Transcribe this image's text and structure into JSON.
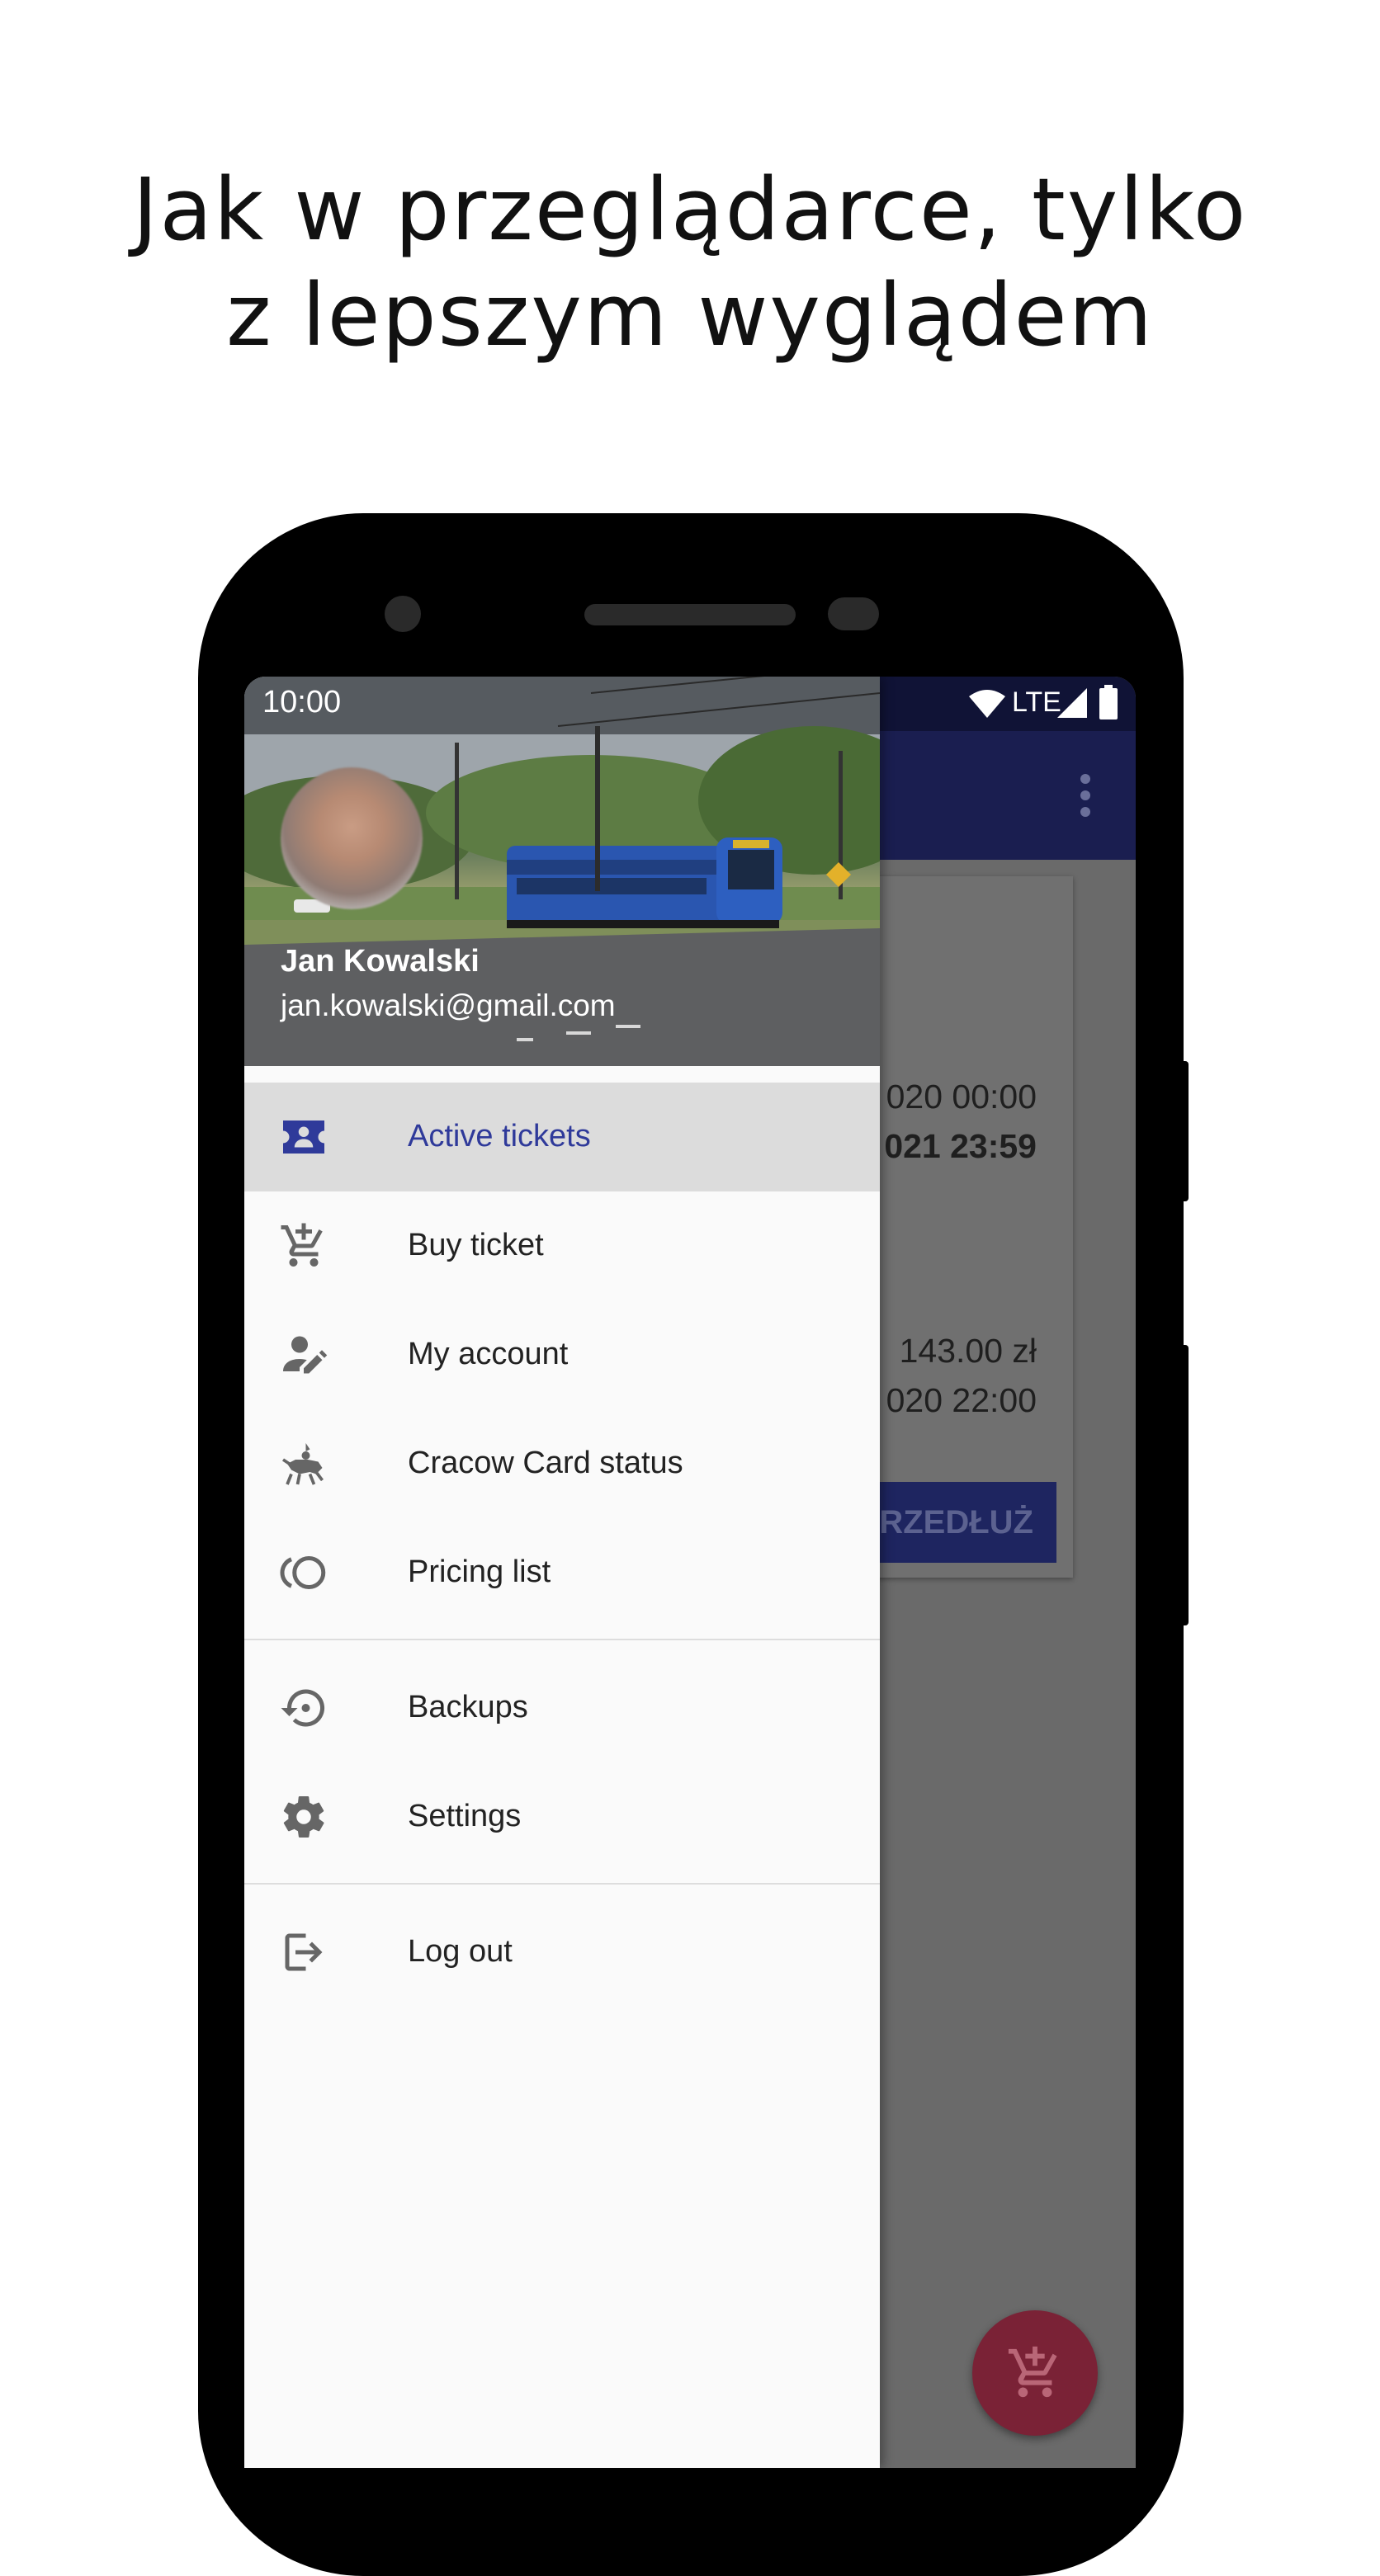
{
  "headline": {
    "line1": "Jak w przeglądarce, tylko",
    "line2": "z lepszym wyglądem"
  },
  "status_bar": {
    "time": "10:00",
    "network": "LTE",
    "icons": [
      "wifi-icon",
      "signal-icon",
      "battery-icon"
    ]
  },
  "drawer": {
    "user_name": "Jan Kowalski",
    "user_email": "jan.kowalski@gmail.com",
    "menu": [
      {
        "label": "Active tickets",
        "icon": "ticket-icon",
        "active": true
      },
      {
        "label": "Buy ticket",
        "icon": "cart-add-icon",
        "active": false
      },
      {
        "label": "My account",
        "icon": "account-edit-icon",
        "active": false
      },
      {
        "label": "Cracow Card status",
        "icon": "lajkonik-icon",
        "active": false
      },
      {
        "label": "Pricing list",
        "icon": "coins-icon",
        "active": false
      },
      {
        "label": "Backups",
        "icon": "backup-restore-icon",
        "active": false
      },
      {
        "label": "Settings",
        "icon": "gear-icon",
        "active": false
      },
      {
        "label": "Log out",
        "icon": "logout-icon",
        "active": false
      }
    ]
  },
  "background_ticket": {
    "valid_from": "020 00:00",
    "valid_to": "021 23:59",
    "price": "143.00 zł",
    "purchased": "020 22:00",
    "renew_label": "PRZEDŁUŻ"
  },
  "colors": {
    "accent": "#2f3a9a",
    "app_bar": "#1a1e50",
    "fab": "#7a2236"
  }
}
